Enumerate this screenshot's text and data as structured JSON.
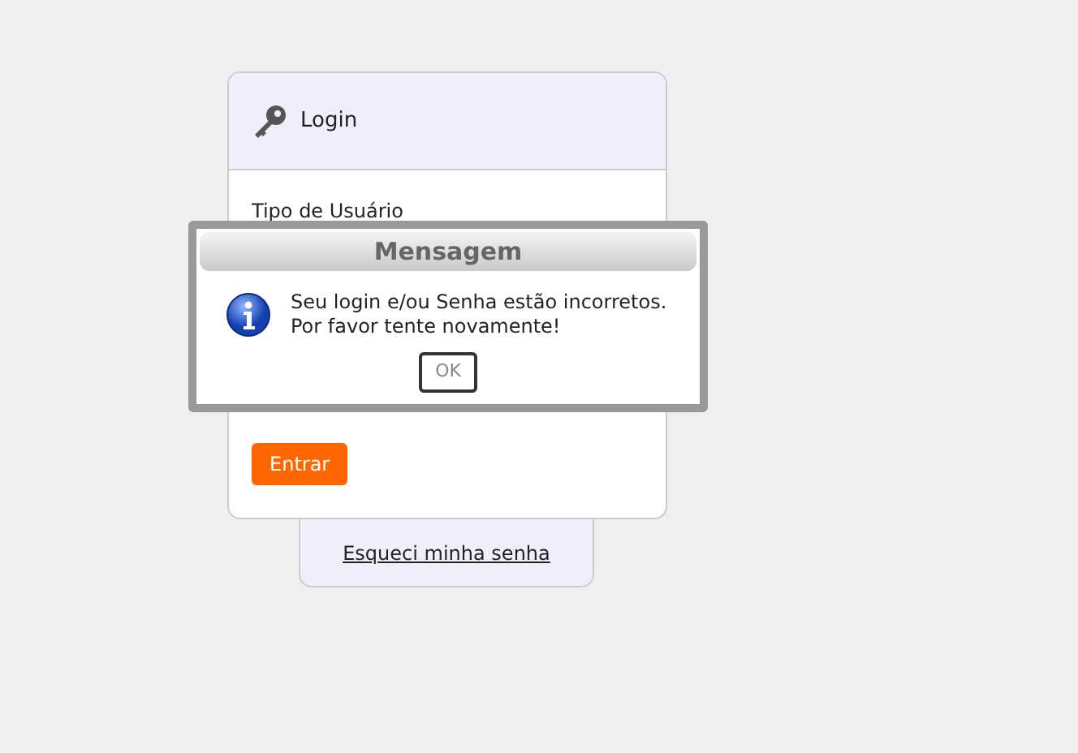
{
  "login_card": {
    "title": "Login",
    "user_type_label": "Tipo de Usuário",
    "submit_button": "Entrar"
  },
  "forgot_link": "Esqueci minha senha",
  "dialog": {
    "title": "Mensagem",
    "message_lines": [
      "Seu login e/ou Senha estão incorretos.",
      "Por favor tente novamente!"
    ],
    "ok_button": "OK"
  }
}
